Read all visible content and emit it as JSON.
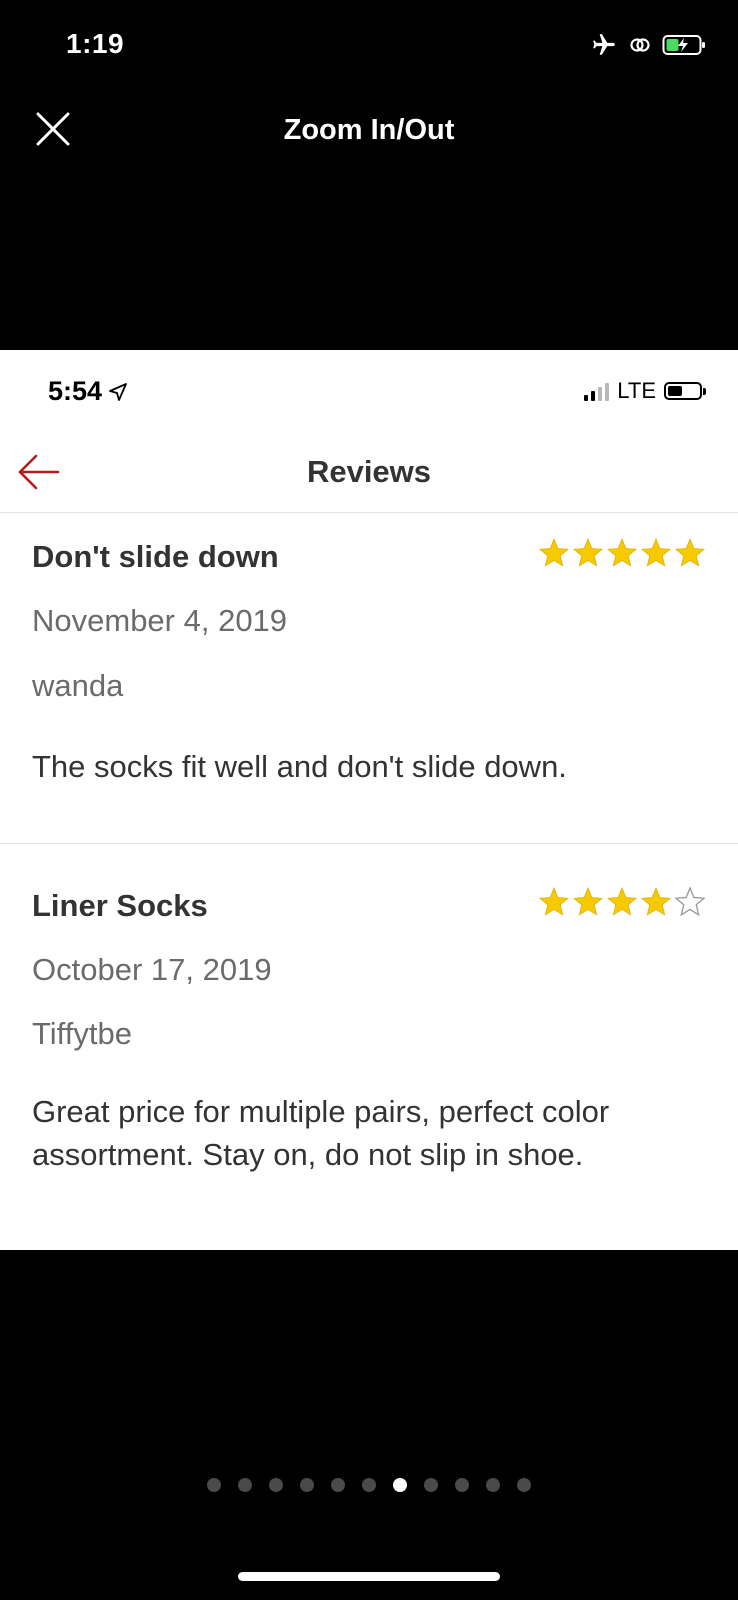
{
  "outer_status": {
    "time": "1:19",
    "icons": [
      "airplane-icon",
      "link-icon",
      "battery-charging-icon"
    ],
    "battery_color": "#4cd964"
  },
  "viewer": {
    "title": "Zoom In/Out",
    "close_icon": "close-icon"
  },
  "inner_status": {
    "time": "5:54",
    "network": "LTE",
    "signal_bars_on": 2,
    "signal_bars_total": 4,
    "battery_level": 0.45
  },
  "header": {
    "title": "Reviews",
    "back_icon": "back-arrow-icon",
    "accent_color": "#b31b1b"
  },
  "reviews": [
    {
      "title": "Don't slide down",
      "rating": 5,
      "max_rating": 5,
      "date": "November 4, 2019",
      "author": "wanda",
      "body": "The socks fit well and don't slide down."
    },
    {
      "title": "Liner Socks",
      "rating": 4,
      "max_rating": 5,
      "date": "October 17, 2019",
      "author": "Tiffytbe",
      "body": "Great price for multiple pairs, perfect color assortment. Stay on, do not slip in shoe."
    }
  ],
  "star_color": "#f7c900",
  "pagination": {
    "total": 11,
    "current": 7
  }
}
